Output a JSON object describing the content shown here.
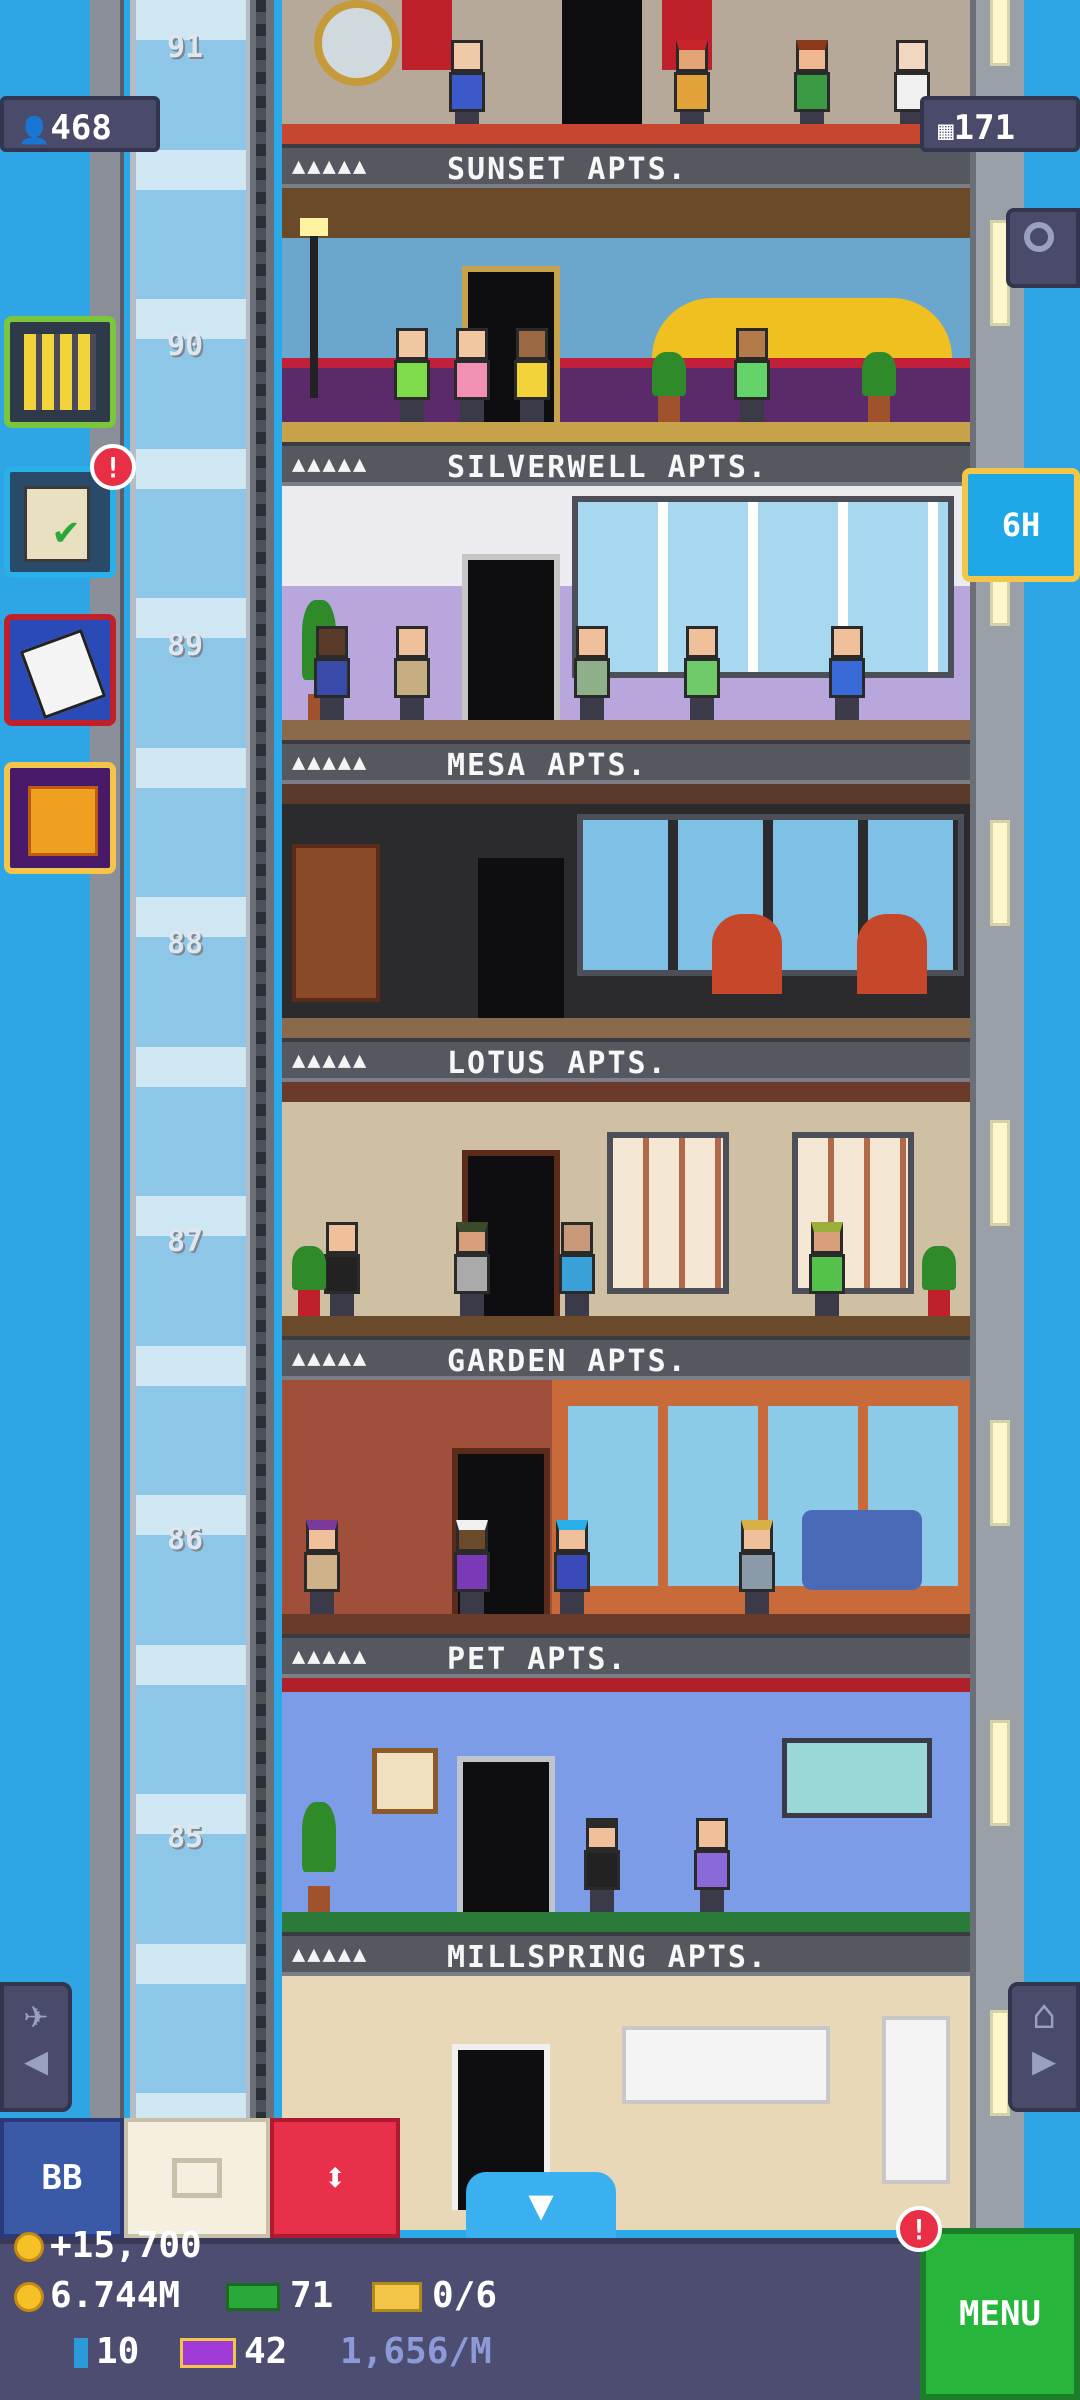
{
  "hud": {
    "population": "468",
    "floors_count": "171",
    "restock_timer": "6H",
    "new_badge": "!",
    "menu_badge": "!"
  },
  "floor_numbers": [
    "91",
    "90",
    "89",
    "88",
    "87",
    "86",
    "85"
  ],
  "floors": [
    {
      "name": "SUNSET APTS.",
      "stars": "▲▲▲▲▲"
    },
    {
      "name": "SILVERWELL APTS.",
      "stars": "▲▲▲▲▲"
    },
    {
      "name": "MESA APTS.",
      "stars": "▲▲▲▲▲"
    },
    {
      "name": "LOTUS APTS.",
      "stars": "▲▲▲▲▲"
    },
    {
      "name": "GARDEN APTS.",
      "stars": "▲▲▲▲▲"
    },
    {
      "name": "PET APTS.",
      "stars": "▲▲▲▲▲"
    },
    {
      "name": "MILLSPRING APTS.",
      "stars": "▲▲▲▲▲"
    }
  ],
  "bottom": {
    "bb_label": "BB",
    "coins_gain": "+15,700",
    "coins_total": "6.744M",
    "bux": "71",
    "tickets": "0/6",
    "items": "10",
    "vip": "42",
    "rate": "1,656/M",
    "menu_label": "MENU"
  },
  "colors": {
    "sky": "#2ea6e6",
    "menu_green": "#27b53b",
    "bar": "#4d4d72",
    "alert_red": "#e82f45",
    "restock_blue": "#1fa8e8"
  }
}
